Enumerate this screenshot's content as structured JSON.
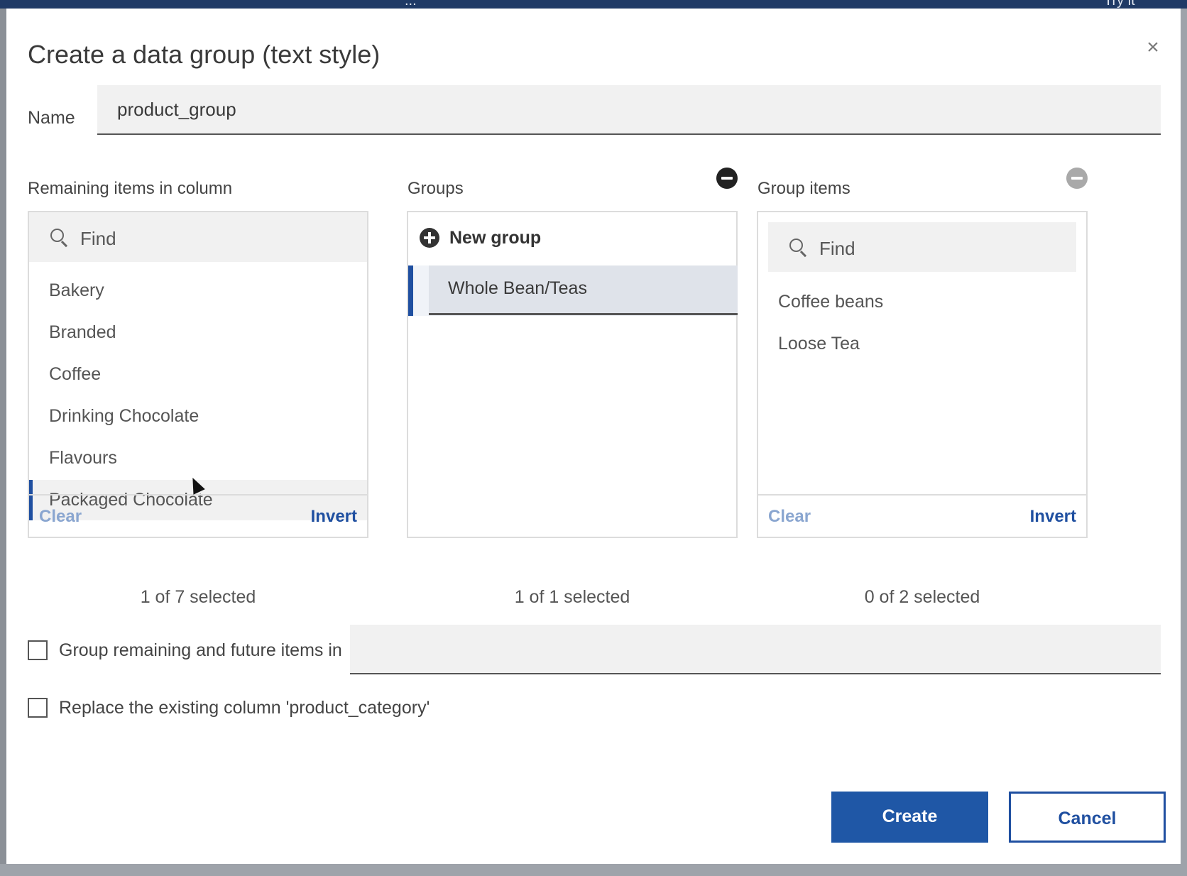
{
  "background": {
    "app_title_fragment": "...",
    "top_right_fragment": "Try it"
  },
  "dialog": {
    "title": "Create a data group (text style)",
    "close_icon": "close-icon",
    "name_label": "Name",
    "name_value": "product_group"
  },
  "remaining": {
    "label": "Remaining items in column",
    "find_placeholder": "Find",
    "items": [
      {
        "label": "Bakery",
        "selected": false
      },
      {
        "label": "Branded",
        "selected": false
      },
      {
        "label": "Coffee",
        "selected": false
      },
      {
        "label": "Drinking Chocolate",
        "selected": false
      },
      {
        "label": "Flavours",
        "selected": false
      },
      {
        "label": "Packaged Chocolate",
        "selected": true
      }
    ],
    "clear_label": "Clear",
    "invert_label": "Invert",
    "count_text": "1 of 7 selected"
  },
  "groups": {
    "label": "Groups",
    "new_group_label": "New group",
    "items": [
      {
        "label": "Whole Bean/Teas",
        "selected": true
      }
    ],
    "count_text": "1 of 1 selected"
  },
  "group_items": {
    "label": "Group items",
    "find_placeholder": "Find",
    "items": [
      {
        "label": "Coffee beans"
      },
      {
        "label": "Loose Tea"
      }
    ],
    "clear_label": "Clear",
    "invert_label": "Invert",
    "count_text": "0 of 2 selected"
  },
  "options": {
    "group_remaining_label": "Group remaining and future items in",
    "group_remaining_value": "",
    "replace_label": "Replace the existing column 'product_category'"
  },
  "actions": {
    "create_label": "Create",
    "cancel_label": "Cancel"
  },
  "colors": {
    "primary": "#1f57a6",
    "selection_bar": "#1f4fa0",
    "link_disabled": "#8aa6d0"
  }
}
